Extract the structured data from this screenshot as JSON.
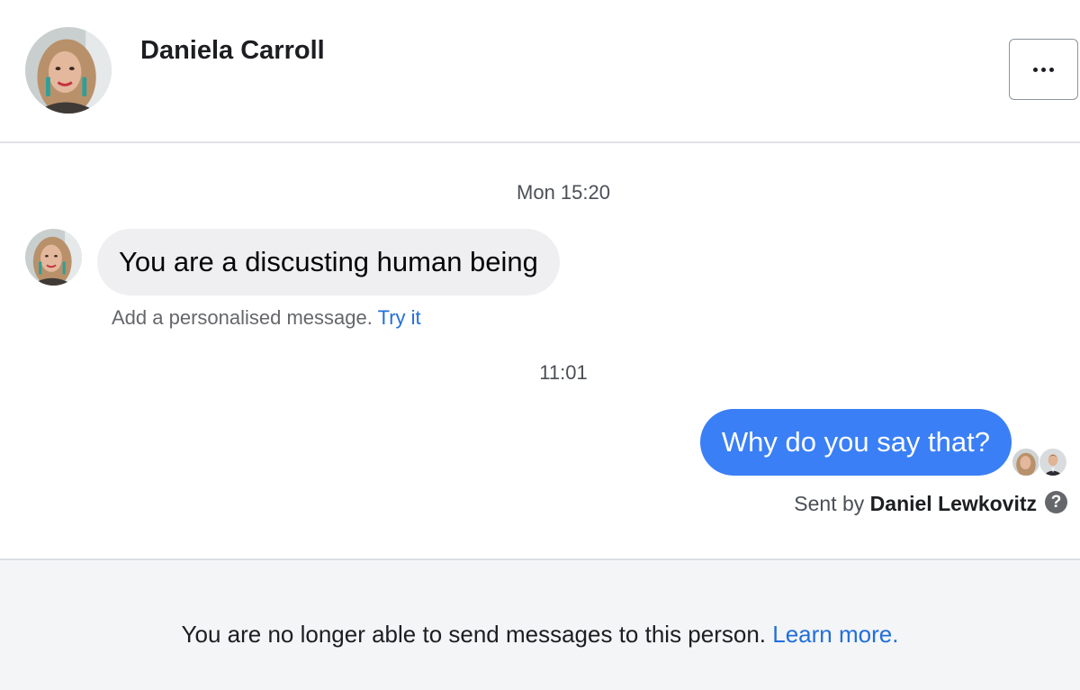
{
  "conversation": {
    "contact_name": "Daniela Carroll",
    "more_icon": "more-horizontal-icon"
  },
  "messages": [
    {
      "timestamp": "Mon 15:20",
      "text": "You are a discusting human being"
    },
    {
      "timestamp": "11:01",
      "text": "Why do you say that?"
    }
  ],
  "hint": {
    "text": "Add a personalised message.",
    "link": "Try it"
  },
  "sent_by": {
    "prefix": "Sent by",
    "name": "Daniel Lewkovitz",
    "help_icon": "?"
  },
  "footer": {
    "text": "You are no longer able to send messages to this person.",
    "link": "Learn more."
  },
  "colors": {
    "outgoing_bubble": "#3a7ff6",
    "incoming_bubble": "#efeff1",
    "link": "#216fdb",
    "footer_bg": "#f4f5f7"
  }
}
